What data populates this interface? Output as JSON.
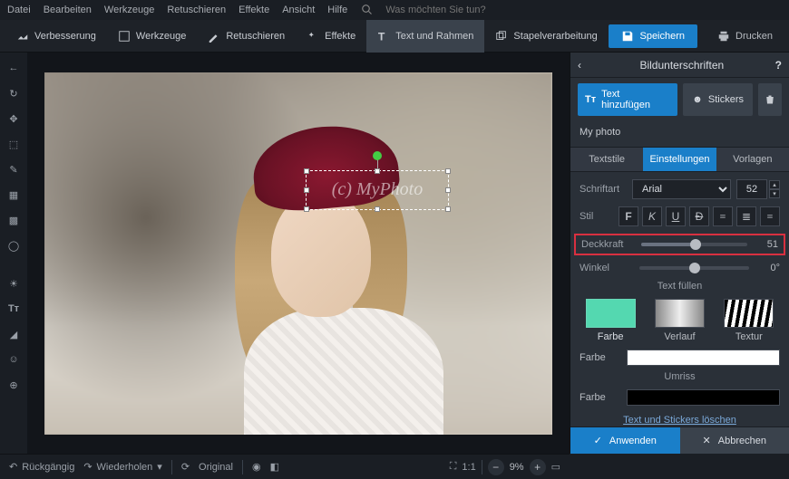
{
  "menu": {
    "items": [
      "Datei",
      "Bearbeiten",
      "Werkzeuge",
      "Retuschieren",
      "Effekte",
      "Ansicht",
      "Hilfe"
    ],
    "search_placeholder": "Was möchten Sie tun?"
  },
  "toolbar": {
    "enhance": "Verbesserung",
    "tools": "Werkzeuge",
    "retouch": "Retuschieren",
    "effects": "Effekte",
    "text_frames": "Text und Rahmen",
    "batch": "Stapelverarbeitung",
    "save": "Speichern",
    "print": "Drucken"
  },
  "watermark": {
    "text": "(c) MyPhoto"
  },
  "panel": {
    "title": "Bildunterschriften",
    "add_text": "Text hinzufügen",
    "stickers": "Stickers",
    "layer_name": "My photo",
    "tabs": {
      "styles": "Textstile",
      "settings": "Einstellungen",
      "templates": "Vorlagen"
    },
    "font_label": "Schriftart",
    "font_value": "Arial",
    "font_size": "52",
    "style_label": "Stil",
    "opacity_label": "Deckkraft",
    "opacity_value": "51",
    "angle_label": "Winkel",
    "angle_value": "0°",
    "fill_title": "Text füllen",
    "fill": {
      "color": "Farbe",
      "gradient": "Verlauf",
      "texture": "Textur"
    },
    "color_label": "Farbe",
    "outline_label": "Umriss",
    "fill_color": "#ffffff",
    "outline_color": "#000000",
    "delete_link": "Text und Stickers löschen",
    "apply": "Anwenden",
    "cancel": "Abbrechen"
  },
  "status": {
    "undo": "Rückgängig",
    "redo": "Wiederholen",
    "original": "Original",
    "ratio": "1:1",
    "zoom": "9%"
  }
}
